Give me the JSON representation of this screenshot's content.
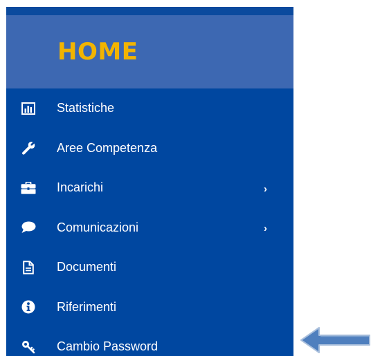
{
  "sidebar": {
    "header": {
      "title": "HOME"
    },
    "items": [
      {
        "label": "Statistiche",
        "icon": "bar-chart-icon",
        "has_submenu": false
      },
      {
        "label": "Aree Competenza",
        "icon": "wrench-icon",
        "has_submenu": false
      },
      {
        "label": "Incarichi",
        "icon": "briefcase-icon",
        "has_submenu": true,
        "chevron": "›"
      },
      {
        "label": "Comunicazioni",
        "icon": "speech-bubble-icon",
        "has_submenu": true,
        "chevron": "›"
      },
      {
        "label": "Documenti",
        "icon": "document-icon",
        "has_submenu": false
      },
      {
        "label": "Riferimenti",
        "icon": "info-icon",
        "has_submenu": false
      },
      {
        "label": "Cambio Password",
        "icon": "key-icon",
        "has_submenu": false
      }
    ]
  },
  "annotation": {
    "icon": "left-arrow-icon"
  },
  "colors": {
    "sidebar_bg": "#0047a0",
    "header_bg": "#3d68b2",
    "title": "#f2b400",
    "text": "#ffffff",
    "arrow_fill": "#4f7fbe"
  }
}
